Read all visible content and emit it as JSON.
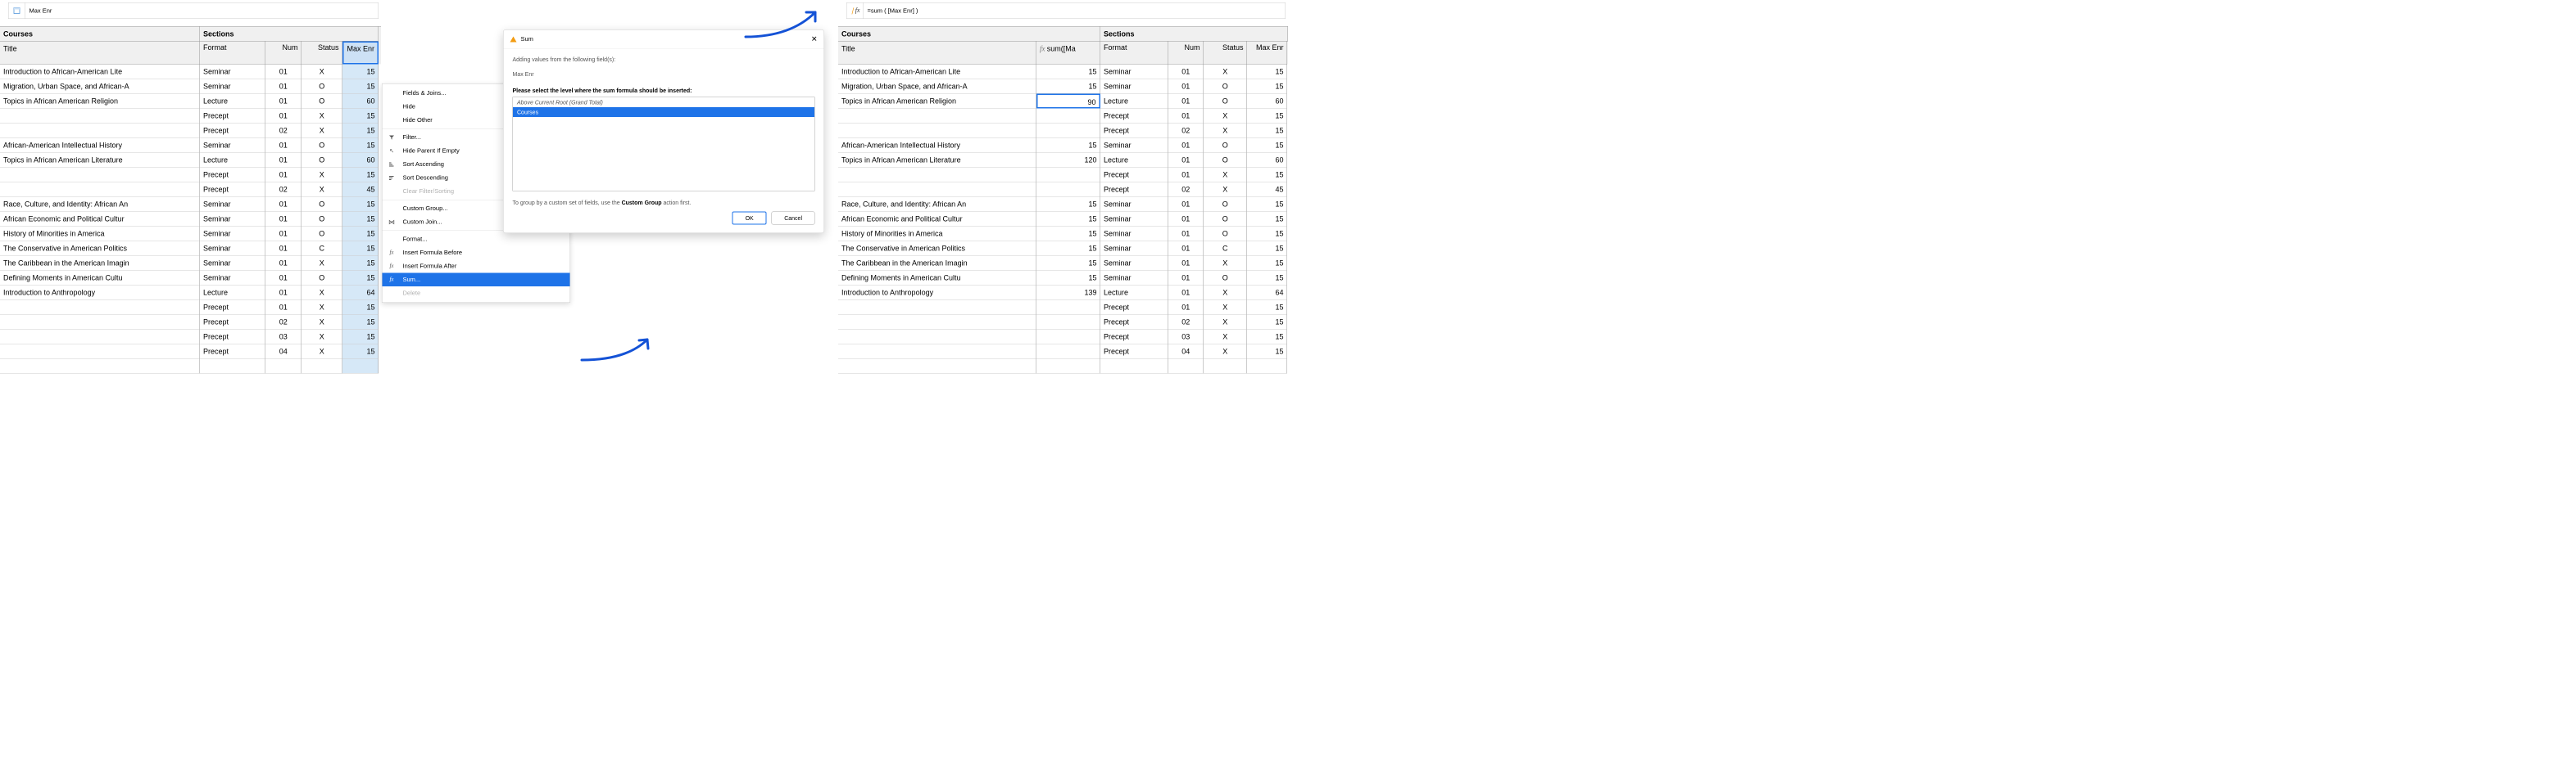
{
  "left": {
    "formula_label": "Max Enr",
    "courses_header": "Courses",
    "title_header": "Title",
    "sections_header": "Sections",
    "subheaders": {
      "format": "Format",
      "num": "Num",
      "status": "Status",
      "maxenr": "Max Enr"
    },
    "rows": [
      {
        "title": "Introduction to African-American Lite",
        "sections": [
          {
            "format": "Seminar",
            "num": "01",
            "status": "X",
            "maxenr": "15"
          }
        ]
      },
      {
        "title": "Migration, Urban Space, and African-A",
        "sections": [
          {
            "format": "Seminar",
            "num": "01",
            "status": "O",
            "maxenr": "15"
          }
        ]
      },
      {
        "title": "Topics in African American Religion",
        "sections": [
          {
            "format": "Lecture",
            "num": "01",
            "status": "O",
            "maxenr": "60"
          },
          {
            "format": "Precept",
            "num": "01",
            "status": "X",
            "maxenr": "15"
          },
          {
            "format": "Precept",
            "num": "02",
            "status": "X",
            "maxenr": "15"
          }
        ]
      },
      {
        "title": "African-American Intellectual History",
        "sections": [
          {
            "format": "Seminar",
            "num": "01",
            "status": "O",
            "maxenr": "15"
          }
        ]
      },
      {
        "title": "Topics in African American Literature",
        "sections": [
          {
            "format": "Lecture",
            "num": "01",
            "status": "O",
            "maxenr": "60"
          },
          {
            "format": "Precept",
            "num": "01",
            "status": "X",
            "maxenr": "15"
          },
          {
            "format": "Precept",
            "num": "02",
            "status": "X",
            "maxenr": "45"
          }
        ]
      },
      {
        "title": "Race, Culture, and Identity: African An",
        "sections": [
          {
            "format": "Seminar",
            "num": "01",
            "status": "O",
            "maxenr": "15"
          }
        ]
      },
      {
        "title": "African Economic and Political Cultur",
        "sections": [
          {
            "format": "Seminar",
            "num": "01",
            "status": "O",
            "maxenr": "15"
          }
        ]
      },
      {
        "title": "History of Minorities in America",
        "sections": [
          {
            "format": "Seminar",
            "num": "01",
            "status": "O",
            "maxenr": "15"
          }
        ]
      },
      {
        "title": "The Conservative in American Politics",
        "sections": [
          {
            "format": "Seminar",
            "num": "01",
            "status": "C",
            "maxenr": "15"
          }
        ]
      },
      {
        "title": "The Caribbean in the American Imagin",
        "sections": [
          {
            "format": "Seminar",
            "num": "01",
            "status": "X",
            "maxenr": "15"
          }
        ]
      },
      {
        "title": "Defining Moments in American Cultu",
        "sections": [
          {
            "format": "Seminar",
            "num": "01",
            "status": "O",
            "maxenr": "15"
          }
        ]
      },
      {
        "title": "Introduction to Anthropology",
        "sections": [
          {
            "format": "Lecture",
            "num": "01",
            "status": "X",
            "maxenr": "64"
          },
          {
            "format": "Precept",
            "num": "01",
            "status": "X",
            "maxenr": "15"
          },
          {
            "format": "Precept",
            "num": "02",
            "status": "X",
            "maxenr": "15"
          },
          {
            "format": "Precept",
            "num": "03",
            "status": "X",
            "maxenr": "15"
          },
          {
            "format": "Precept",
            "num": "04",
            "status": "X",
            "maxenr": "15"
          },
          {
            "format": "",
            "num": "",
            "status": "",
            "maxenr": ""
          }
        ]
      }
    ]
  },
  "context_menu": {
    "items": [
      {
        "label": "Fields & Joins...",
        "icon": ""
      },
      {
        "label": "Hide",
        "icon": ""
      },
      {
        "label": "Hide Other",
        "icon": ""
      },
      {
        "sep": true
      },
      {
        "label": "Filter...",
        "icon": "filter"
      },
      {
        "label": "Hide Parent If Empty",
        "icon": "arrow-nw"
      },
      {
        "label": "Sort Ascending",
        "icon": "sort-asc"
      },
      {
        "label": "Sort Descending",
        "icon": "sort-desc"
      },
      {
        "label": "Clear Filter/Sorting",
        "icon": "",
        "disabled": true
      },
      {
        "sep": true
      },
      {
        "label": "Custom Group...",
        "icon": ""
      },
      {
        "label": "Custom Join...",
        "icon": "join"
      },
      {
        "sep": true
      },
      {
        "label": "Format...",
        "icon": ""
      },
      {
        "label": "Insert Formula Before",
        "icon": "fx"
      },
      {
        "label": "Insert Formula After",
        "icon": "fx"
      },
      {
        "label": "Sum...",
        "icon": "fx",
        "selected": true
      },
      {
        "label": "Delete",
        "icon": "",
        "disabled": true
      }
    ]
  },
  "dialog": {
    "title": "Sum",
    "intro": "Adding values from the following field(s):",
    "fields": "Max Enr",
    "prompt": "Please select the level where the sum formula should be inserted:",
    "levels": [
      {
        "label": "Above Current Root (Grand Total)",
        "italic": true
      },
      {
        "label": "Courses",
        "selected": true
      }
    ],
    "hint_prefix": "To group by a custom set of fields, use the ",
    "hint_bold": "Custom Group",
    "hint_suffix": " action first.",
    "ok": "OK",
    "cancel": "Cancel"
  },
  "right": {
    "formula_label": "=sum ( [Max Enr] )",
    "courses_header": "Courses",
    "title_header": "Title",
    "sum_header_fx": "fx",
    "sum_header": "sum([Ma",
    "sections_header": "Sections",
    "subheaders": {
      "format": "Format",
      "num": "Num",
      "status": "Status",
      "maxenr": "Max Enr"
    },
    "rows": [
      {
        "title": "Introduction to African-American Lite",
        "sum": "15",
        "sections": [
          {
            "format": "Seminar",
            "num": "01",
            "status": "X",
            "maxenr": "15"
          }
        ]
      },
      {
        "title": "Migration, Urban Space, and African-A",
        "sum": "15",
        "sections": [
          {
            "format": "Seminar",
            "num": "01",
            "status": "O",
            "maxenr": "15"
          }
        ]
      },
      {
        "title": "Topics in African American Religion",
        "sum": "90",
        "selected": true,
        "sections": [
          {
            "format": "Lecture",
            "num": "01",
            "status": "O",
            "maxenr": "60"
          },
          {
            "format": "Precept",
            "num": "01",
            "status": "X",
            "maxenr": "15"
          },
          {
            "format": "Precept",
            "num": "02",
            "status": "X",
            "maxenr": "15"
          }
        ]
      },
      {
        "title": "African-American Intellectual History",
        "sum": "15",
        "sections": [
          {
            "format": "Seminar",
            "num": "01",
            "status": "O",
            "maxenr": "15"
          }
        ]
      },
      {
        "title": "Topics in African American Literature",
        "sum": "120",
        "sections": [
          {
            "format": "Lecture",
            "num": "01",
            "status": "O",
            "maxenr": "60"
          },
          {
            "format": "Precept",
            "num": "01",
            "status": "X",
            "maxenr": "15"
          },
          {
            "format": "Precept",
            "num": "02",
            "status": "X",
            "maxenr": "45"
          }
        ]
      },
      {
        "title": "Race, Culture, and Identity: African An",
        "sum": "15",
        "sections": [
          {
            "format": "Seminar",
            "num": "01",
            "status": "O",
            "maxenr": "15"
          }
        ]
      },
      {
        "title": "African Economic and Political Cultur",
        "sum": "15",
        "sections": [
          {
            "format": "Seminar",
            "num": "01",
            "status": "O",
            "maxenr": "15"
          }
        ]
      },
      {
        "title": "History of Minorities in America",
        "sum": "15",
        "sections": [
          {
            "format": "Seminar",
            "num": "01",
            "status": "O",
            "maxenr": "15"
          }
        ]
      },
      {
        "title": "The Conservative in American Politics",
        "sum": "15",
        "sections": [
          {
            "format": "Seminar",
            "num": "01",
            "status": "C",
            "maxenr": "15"
          }
        ]
      },
      {
        "title": "The Caribbean in the American Imagin",
        "sum": "15",
        "sections": [
          {
            "format": "Seminar",
            "num": "01",
            "status": "X",
            "maxenr": "15"
          }
        ]
      },
      {
        "title": "Defining Moments in American Cultu",
        "sum": "15",
        "sections": [
          {
            "format": "Seminar",
            "num": "01",
            "status": "O",
            "maxenr": "15"
          }
        ]
      },
      {
        "title": "Introduction to Anthropology",
        "sum": "139",
        "sections": [
          {
            "format": "Lecture",
            "num": "01",
            "status": "X",
            "maxenr": "64"
          },
          {
            "format": "Precept",
            "num": "01",
            "status": "X",
            "maxenr": "15"
          },
          {
            "format": "Precept",
            "num": "02",
            "status": "X",
            "maxenr": "15"
          },
          {
            "format": "Precept",
            "num": "03",
            "status": "X",
            "maxenr": "15"
          },
          {
            "format": "Precept",
            "num": "04",
            "status": "X",
            "maxenr": "15"
          },
          {
            "format": "",
            "num": "",
            "status": "",
            "maxenr": ""
          }
        ]
      }
    ]
  }
}
